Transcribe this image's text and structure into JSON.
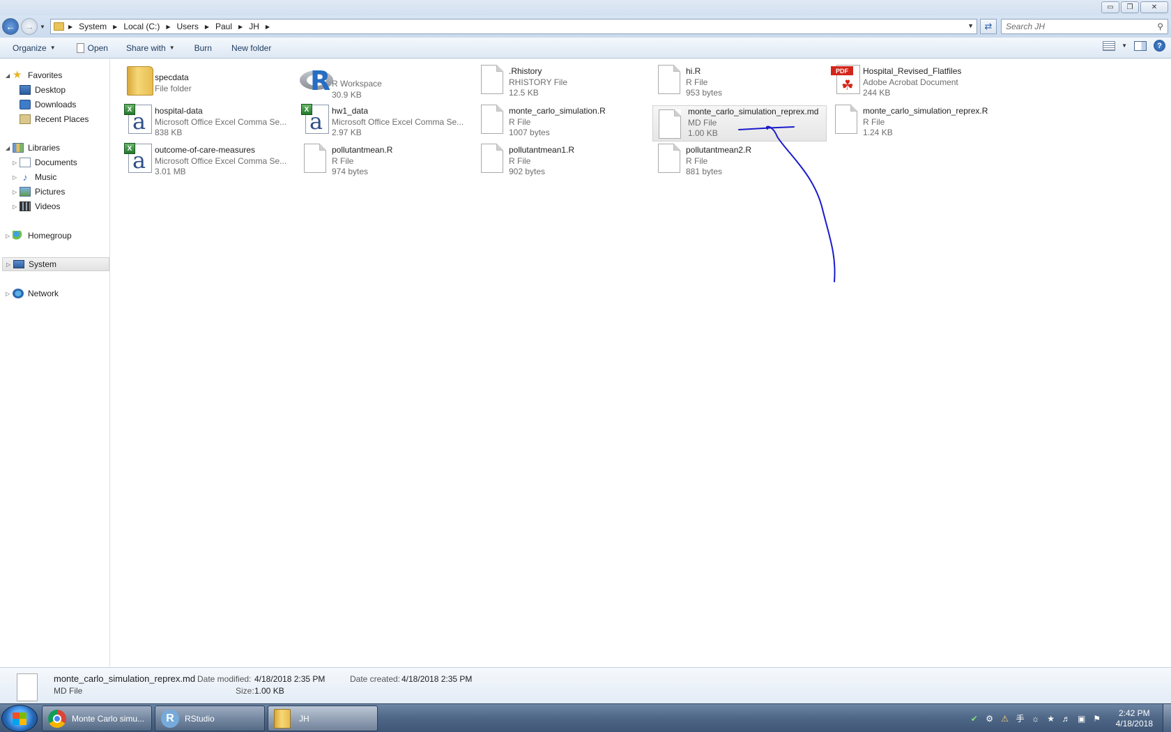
{
  "window": {
    "minimize_glyph": "▭",
    "restore_glyph": "❐",
    "close_glyph": "✕"
  },
  "address": {
    "crumbs": [
      "System",
      "Local (C:)",
      "Users",
      "Paul",
      "JH"
    ],
    "search_placeholder": "Search JH"
  },
  "toolbar": {
    "organize": "Organize",
    "open": "Open",
    "share_with": "Share with",
    "burn": "Burn",
    "new_folder": "New folder",
    "help": "?"
  },
  "nav": {
    "favorites": "Favorites",
    "desktop": "Desktop",
    "downloads": "Downloads",
    "recent_places": "Recent Places",
    "libraries": "Libraries",
    "documents": "Documents",
    "music": "Music",
    "pictures": "Pictures",
    "videos": "Videos",
    "homegroup": "Homegroup",
    "system": "System",
    "network": "Network"
  },
  "files": [
    {
      "name": "specdata",
      "type": "File folder",
      "size": "",
      "icon": "folder-icon"
    },
    {
      "name": "",
      "type": "R Workspace",
      "size": "30.9 KB",
      "icon": "r-workspace-icon"
    },
    {
      "name": ".Rhistory",
      "type": "RHISTORY File",
      "size": "12.5 KB",
      "icon": "generic-file-icon"
    },
    {
      "name": "hi.R",
      "type": "R File",
      "size": "953 bytes",
      "icon": "generic-file-icon"
    },
    {
      "name": "Hospital_Revised_Flatfiles",
      "type": "Adobe Acrobat Document",
      "size": "244 KB",
      "icon": "pdf-icon"
    },
    {
      "name": "hospital-data",
      "type": "Microsoft Office Excel Comma Se...",
      "size": "838 KB",
      "icon": "excel-csv-icon"
    },
    {
      "name": "hw1_data",
      "type": "Microsoft Office Excel Comma Se...",
      "size": "2.97 KB",
      "icon": "excel-csv-icon"
    },
    {
      "name": "monte_carlo_simulation.R",
      "type": "R File",
      "size": "1007 bytes",
      "icon": "generic-file-icon"
    },
    {
      "name": "monte_carlo_simulation_reprex.md",
      "type": "MD File",
      "size": "1.00 KB",
      "icon": "generic-file-icon",
      "selected": true
    },
    {
      "name": "monte_carlo_simulation_reprex.R",
      "type": "R File",
      "size": "1.24 KB",
      "icon": "generic-file-icon"
    },
    {
      "name": "outcome-of-care-measures",
      "type": "Microsoft Office Excel Comma Se...",
      "size": "3.01 MB",
      "icon": "excel-csv-icon"
    },
    {
      "name": "pollutantmean.R",
      "type": "R File",
      "size": "974 bytes",
      "icon": "generic-file-icon"
    },
    {
      "name": "pollutantmean1.R",
      "type": "R File",
      "size": "902 bytes",
      "icon": "generic-file-icon"
    },
    {
      "name": "pollutantmean2.R",
      "type": "R File",
      "size": "881 bytes",
      "icon": "generic-file-icon"
    }
  ],
  "details": {
    "name": "monte_carlo_simulation_reprex.md",
    "type": "MD File",
    "date_modified_label": "Date modified:",
    "date_modified": "4/18/2018 2:35 PM",
    "date_created_label": "Date created:",
    "date_created": "4/18/2018 2:35 PM",
    "size_label": "Size:",
    "size": "1.00 KB"
  },
  "taskbar": {
    "chrome": "Monte Carlo simu...",
    "rstudio": "RStudio",
    "explorer": "JH",
    "rstudio_glyph": "R",
    "time": "2:42 PM",
    "date": "4/18/2018"
  },
  "colors": {
    "annotation_stroke": "#1a1acc",
    "accent": "#2b5fa8"
  }
}
